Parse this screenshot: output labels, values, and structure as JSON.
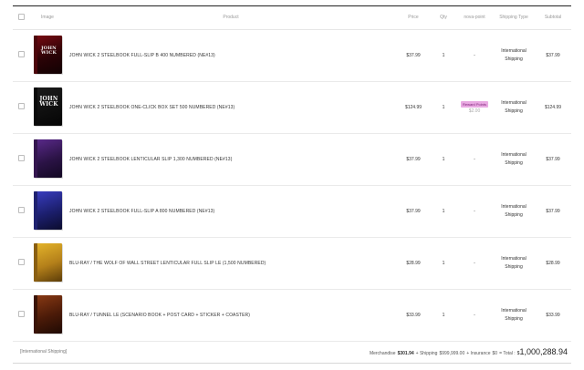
{
  "headers": {
    "image": "Image",
    "product": "Product",
    "price": "Price",
    "qty": "Qty",
    "point": "nova-point",
    "shipping": "Shipping Type",
    "subtotal": "Subtotal"
  },
  "rows": [
    {
      "name": "JOHN WICK 2 STEELBOOK FULL-SLIP B 400 NUMBERED (NE#13)",
      "thumb_title": "JOHN WICK",
      "price": "$37.99",
      "qty": "1",
      "point": "-",
      "shipping_line1": "International",
      "shipping_line2": "Shipping",
      "subtotal": "$37.99"
    },
    {
      "name": "JOHN WICK 2 STEELBOOK ONE-CLICK BOX SET 500 NUMBERED (NE#13)",
      "thumb_title": "JOHN WICK",
      "price": "$124.99",
      "qty": "1",
      "point_badge": "Reward Points",
      "point": "$2.00",
      "shipping_line1": "International",
      "shipping_line2": "Shipping",
      "subtotal": "$124.99"
    },
    {
      "name": "JOHN WICK 2 STEELBOOK LENTICULAR SLIP 1,300 NUMBERED (NE#13)",
      "price": "$37.99",
      "qty": "1",
      "point": "-",
      "shipping_line1": "International",
      "shipping_line2": "Shipping",
      "subtotal": "$37.99"
    },
    {
      "name": "JOHN WICK 2 STEELBOOK FULL-SLIP A 800 NUMBERED (NE#13)",
      "price": "$37.99",
      "qty": "1",
      "point": "-",
      "shipping_line1": "International",
      "shipping_line2": "Shipping",
      "subtotal": "$37.99"
    },
    {
      "name": "BLU-RAY / THE WOLF OF WALL STREET LENTICULAR FULL SLIP LE (1,500 NUMBERED)",
      "price": "$28.99",
      "qty": "1",
      "point": "-",
      "shipping_line1": "International",
      "shipping_line2": "Shipping",
      "subtotal": "$28.99"
    },
    {
      "name": "BLU-RAY / TUNNEL LE (SCENARIO BOOK + POST CARD + STICKER + COASTER)",
      "price": "$33.99",
      "qty": "1",
      "point": "-",
      "shipping_line1": "International",
      "shipping_line2": "Shipping",
      "subtotal": "$33.99"
    }
  ],
  "footer": {
    "group_label": "[International Shipping]",
    "merchandise_label": "Merchandise",
    "merchandise_value": "$301.94",
    "shipping_label": "+ Shipping",
    "shipping_value": "$999,999.00",
    "insurance_label": "+ Insurance",
    "insurance_value": "$0",
    "total_label": "= Total :",
    "total_currency": "$",
    "total_value": "1,000,288.94"
  }
}
